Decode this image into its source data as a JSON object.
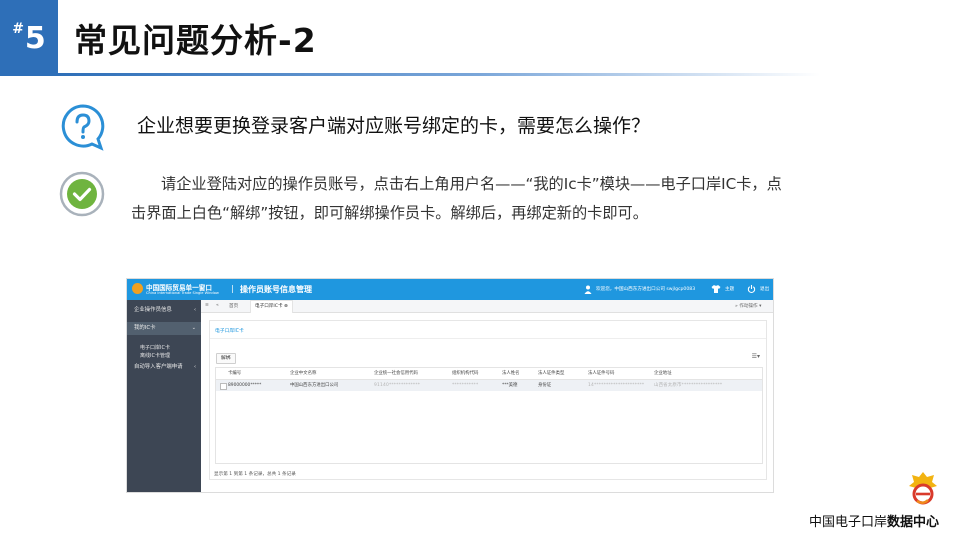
{
  "slide": {
    "badge_hash": "#",
    "badge_number": "5",
    "title": "常见问题分析-2",
    "question": "企业想要更换登录客户端对应账号绑定的卡，需要怎么操作？",
    "answer": "请企业登陆对应的操作员账号，点击右上角用户名——“我的Ic卡”模块——电子口岸IC卡，点击界面上白色“解绑”按钮，即可解绑操作员卡。解绑后，再绑定新的卡即可。",
    "footer_normal": "中国电子口岸",
    "footer_bold": "数据中心"
  },
  "screenshot": {
    "topbar": {
      "logo_cn": "中国国际贸易单一窗口",
      "logo_en": "China International Trade Single Window",
      "separator": "|",
      "system_title": "操作员账号信息管理",
      "welcome": "欢迎您，中国山西东方进出口公司 swjlgcp0083",
      "theme": "主题",
      "logout": "退出"
    },
    "sidebar": {
      "items": [
        {
          "label": "企业操作员信息",
          "arrow": "‹"
        },
        {
          "label": "我的IC卡",
          "arrow": "⌄"
        },
        {
          "label": "自动导入客户端申请",
          "arrow": "‹"
        }
      ],
      "subitems": [
        "电子口岸IC卡",
        "离线IC卡管理"
      ]
    },
    "tabbar": {
      "nav": [
        "≡",
        "«",
        "首页"
      ],
      "active_tab": "电子口岸IC卡 ⊗",
      "right": "» 作动操作 ▾"
    },
    "panel": {
      "breadcrumb": "电子口岸IC卡",
      "unbind_button": "解绑",
      "table_menu": "☰▾",
      "columns": [
        "卡编号",
        "企业中文名称",
        "企业统一社会信用代码",
        "组织机构代码",
        "法人姓名",
        "法人证件类型",
        "法人证件号码",
        "企业地址"
      ],
      "row": [
        "89000000*****",
        "中国山西东方进出口公司",
        "91140*************",
        "***********",
        "***美德",
        "身份证",
        "14*********************",
        "山西省太原市*****************"
      ],
      "pager": "显示第 1 到第 1 条记录，总共 1 条记录"
    }
  },
  "colors": {
    "badge": "#2e6fb8",
    "topbar": "#1f97df",
    "sidebar": "#3d4654",
    "question_icon": "#2b8fd6",
    "check_icon": "#6fb43f"
  }
}
